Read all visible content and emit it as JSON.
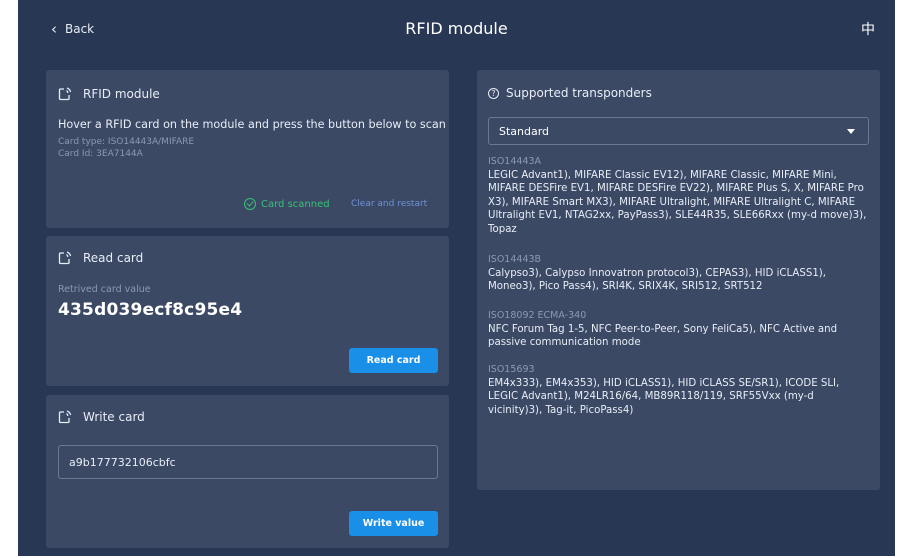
{
  "header": {
    "back_label": "Back",
    "title": "RFID module",
    "language": "中"
  },
  "scan_card": {
    "title": "RFID module",
    "hint": "Hover a RFID card on the module and press the button below to scan",
    "card_type": "Card type: ISO14443A/MIFARE",
    "card_id": "Card Id: 3EA7144A",
    "status": "Card scanned",
    "clear_label": "Clear and restart"
  },
  "read_card": {
    "title": "Read card",
    "value_label": "Retrived card value",
    "value": "435d039ecf8c95e4",
    "button_label": "Read card"
  },
  "write_card": {
    "title": "Write card",
    "input_value": "a9b177732106cbfc",
    "button_label": "Write value"
  },
  "transponders": {
    "title": "Supported transponders",
    "selected": "Standard",
    "standards": [
      {
        "name": "ISO14443A",
        "desc": "LEGIC Advant1), MIFARE Classic EV12), MIFARE Classic, MIFARE Mini, MIFARE DESFire EV1, MIFARE DESFire EV22), MIFARE Plus S, X, MIFARE Pro X3), MIFARE Smart MX3), MIFARE Ultralight, MIFARE Ultralight C, MIFARE Ultralight EV1, NTAG2xx, PayPass3), SLE44R35, SLE66Rxx (my-d move)3), Topaz"
      },
      {
        "name": "ISO14443B",
        "desc": "Calypso3), Calypso Innovatron protocol3), CEPAS3), HID iCLASS1), Moneo3), Pico Pass4), SRI4K, SRIX4K, SRI512, SRT512"
      },
      {
        "name": "ISO18092 ECMA-340",
        "desc": "NFC Forum Tag 1-5, NFC Peer-to-Peer, Sony FeliCa5), NFC Active and passive communication mode"
      },
      {
        "name": "ISO15693",
        "desc": "EM4x333), EM4x353), HID iCLASS1), HID iCLASS SE/SR1), ICODE SLI, LEGIC Advant1), M24LR16/64, MB89R118/119, SRF55Vxx (my-d vicinity)3), Tag-it, PicoPass4)"
      }
    ]
  }
}
